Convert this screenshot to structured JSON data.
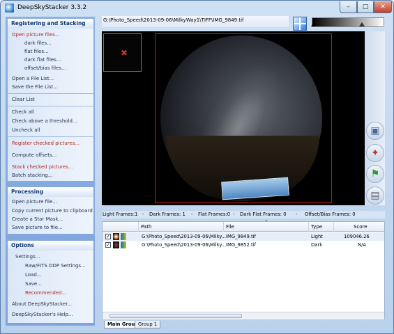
{
  "window": {
    "title": "DeepSkyStacker 3.3.2",
    "min": "–",
    "max": "□",
    "close": "✕"
  },
  "path": "G:\\Photo_Speed\\2013-09-06\\MilkyWay1\\TIFF\\IMG_9849.tif",
  "registering": {
    "title": "Registering and Stacking",
    "open_pictures": "Open picture files...",
    "dark_files": "dark files...",
    "flat_files": "flat files...",
    "dark_flat_files": "dark flat files...",
    "offset_bias_files": "offset/bias files...",
    "open_file_list": "Open a File List...",
    "save_file_list": "Save the File List...",
    "clear_list": "Clear List",
    "check_all": "Check all",
    "check_above": "Check above a threshold...",
    "uncheck_all": "Uncheck all",
    "register_checked": "Register checked pictures...",
    "compute_offsets": "Compute offsets...",
    "stack_checked": "Stack checked pictures...",
    "batch_stacking": "Batch stacking..."
  },
  "processing": {
    "title": "Processing",
    "open_picture": "Open picture file...",
    "copy_picture": "Copy current picture to clipboard",
    "create_star_mask": "Create a Star Mask...",
    "save_picture": "Save picture to file..."
  },
  "options": {
    "title": "Options",
    "settings": "Settings...",
    "raw_settings": "Raw/FITS DDP Settings...",
    "load": "Load...",
    "save": "Save...",
    "recommended": "Recommended...",
    "about": "About DeepSkyStacker...",
    "help": "DeepSkyStacker's Help..."
  },
  "summary": {
    "light": "Light Frames:1",
    "dark": "Dark Frames: 1",
    "flat": "Flat Frames:0",
    "dark_flat": "Dark Flat Frames: 0",
    "offset": "Offset/Bias Frames: 0",
    "sep": "-"
  },
  "list": {
    "columns": [
      "Path",
      "File",
      "Type",
      "Score"
    ],
    "rows": [
      {
        "checked": "✓",
        "path": "G:\\Photo_Speed\\2013-09-06\\Milky...",
        "file": "IMG_9849.tif",
        "type": "Light",
        "score": "109046.26"
      },
      {
        "checked": "✓",
        "path": "G:\\Photo_Speed\\2013-09-06\\Milky...",
        "file": "IMG_9852.tif",
        "type": "Dark",
        "score": "N/A"
      }
    ],
    "sort_indicator": "˄"
  },
  "tabs": [
    "Main Group",
    "Group 1"
  ],
  "icons": {
    "thumb_marker": "✖",
    "tool1": "▣",
    "tool2": "✦",
    "tool3": "⚑",
    "tool4": "▤"
  }
}
